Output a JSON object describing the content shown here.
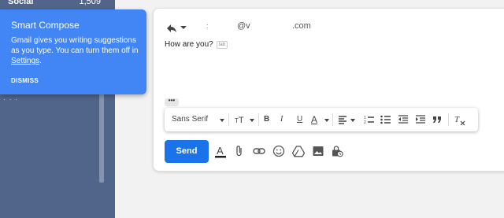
{
  "sidebar": {
    "label": "Social",
    "count": "1,509",
    "fragment": "·  ·  ·"
  },
  "compose": {
    "recipient_prefix": ":",
    "recipient_at": "@v",
    "recipient_domain": ".com",
    "body_text": "How are you?",
    "tab_hint": "tab",
    "more_label": "•••",
    "send_label": "Send"
  },
  "format_bar": {
    "font_name": "Sans Serif",
    "bold": "B",
    "italic": "I",
    "underline": "U",
    "text_color": "A"
  },
  "tooltip": {
    "title": "Smart Compose",
    "body_before": "Gmail gives you writing suggestions as you type. You can turn them off in ",
    "link": "Settings",
    "body_after": ".",
    "dismiss": "DISMISS"
  },
  "colors": {
    "sidebar": "#51648a",
    "tooltip": "#4285f4",
    "send": "#1a73e8"
  },
  "icons": [
    "reply-icon",
    "text-size-icon",
    "align-icon",
    "numbered-list-icon",
    "bulleted-list-icon",
    "indent-less-icon",
    "indent-more-icon",
    "quote-icon",
    "remove-formatting-icon",
    "formatting-options-icon",
    "attach-icon",
    "link-icon",
    "emoji-icon",
    "drive-icon",
    "photo-icon",
    "confidential-mode-icon"
  ]
}
